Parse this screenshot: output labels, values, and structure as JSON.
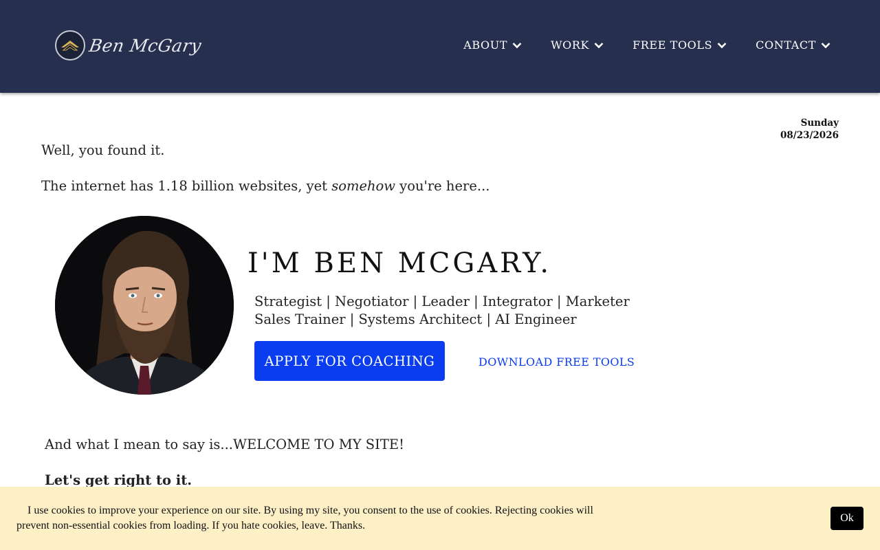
{
  "brand": {
    "logo_text": "Ben McGary",
    "logo_icon": "eagle-emblem-icon"
  },
  "nav": {
    "items": [
      {
        "label": "ABOUT",
        "icon": "chevron-down-icon"
      },
      {
        "label": "WORK",
        "icon": "chevron-down-icon"
      },
      {
        "label": "FREE TOOLS",
        "icon": "chevron-down-icon"
      },
      {
        "label": "CONTACT",
        "icon": "chevron-down-icon"
      }
    ]
  },
  "date": {
    "weekday": "Sunday",
    "date": "08/23/2026"
  },
  "intro": {
    "line1": "Well, you found it.",
    "line2_before": "The internet has 1.18 billion websites, yet ",
    "line2_emphasis": "somehow",
    "line2_after": " you're here..."
  },
  "hero": {
    "title": "I'M BEN MCGARY.",
    "roles_line1": "Strategist | Negotiator | Leader | Integrator | Marketer",
    "roles_line2": "Sales Trainer | Systems Architect | AI Engineer",
    "primary_button": "APPLY FOR COACHING",
    "secondary_link": "DOWNLOAD FREE TOOLS"
  },
  "welcome": {
    "line1": "And what I mean to say is...WELCOME TO MY SITE!",
    "line2": "Let's get right to it."
  },
  "cookie_banner": {
    "text": "I use cookies to improve your experience on our site. By using my site, you consent to the use of cookies. Rejecting cookies will prevent non-essential cookies from loading. If you hate cookies, leave. Thanks.",
    "ok_label": "Ok"
  },
  "colors": {
    "header_bg": "#262f4d",
    "accent_blue": "#0a3cf0",
    "cookie_bg": "#fdefc6"
  }
}
